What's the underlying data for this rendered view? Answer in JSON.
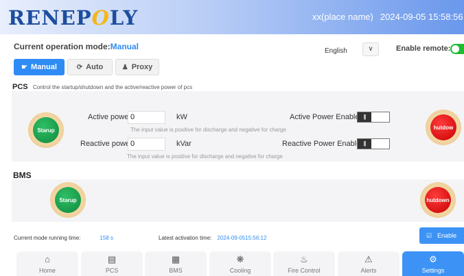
{
  "header": {
    "logo_main": "RENEP",
    "logo_o": "O",
    "logo_end": "LY",
    "place": "xx(place name)",
    "timestamp": "2024-09-05 15:58:56"
  },
  "mode": {
    "label": "Current operation mode:",
    "value": "Manual",
    "language": "English",
    "enable_remote_label": "Enable remote:",
    "enable_remote_on": true
  },
  "tabs": [
    {
      "label": "Manual",
      "icon": "hand-icon",
      "active": true
    },
    {
      "label": "Auto",
      "icon": "cycle-icon",
      "active": false
    },
    {
      "label": "Proxy",
      "icon": "user-icon",
      "active": false
    }
  ],
  "pcs": {
    "title": "PCS",
    "description": "Control the startup/shutdown and the active/reactive power of pcs",
    "start_label": "Starup",
    "stop_label": "hutdow",
    "active_power_label": "Active power",
    "active_power_value": "0",
    "active_power_unit": "kW",
    "active_hint": "The input value is positive for discharge and negative for charge",
    "reactive_power_label": "Reactive power",
    "reactive_power_value": "0",
    "reactive_power_unit": "kVar",
    "reactive_hint": "The input value is positive for discharge and negative for charge",
    "active_enable_label": "Active Power Enable",
    "reactive_enable_label": "Reactive Power Enable",
    "switch_glyph": "|||"
  },
  "bms": {
    "title": "BMS",
    "start_label": "Starup",
    "stop_label": "hutdown"
  },
  "status": {
    "running_label": "Current mode running time:",
    "running_value": "158  s",
    "activation_label": "Latest activation time:",
    "activation_value": "2024-09-0515:56:12",
    "enable_button": "Enable",
    "enable_icon": "check-circle-icon"
  },
  "nav": [
    {
      "label": "Home",
      "icon": "home-icon",
      "active": false
    },
    {
      "label": "PCS",
      "icon": "pcs-icon",
      "active": false
    },
    {
      "label": "BMS",
      "icon": "bms-icon",
      "active": false
    },
    {
      "label": "Cooling",
      "icon": "fan-icon",
      "active": false
    },
    {
      "label": "Fire Control",
      "icon": "fire-icon",
      "active": false
    },
    {
      "label": "Alerts",
      "icon": "alert-icon",
      "active": false
    },
    {
      "label": "Settings",
      "icon": "gear-icon",
      "active": true
    }
  ],
  "colors": {
    "accent": "#2f8cf4",
    "logo_blue": "#1d4e9e",
    "logo_yellow": "#f3b818",
    "start_green": "#0f8a3c",
    "stop_red": "#c80000",
    "toggle_green": "#1fbb33"
  }
}
